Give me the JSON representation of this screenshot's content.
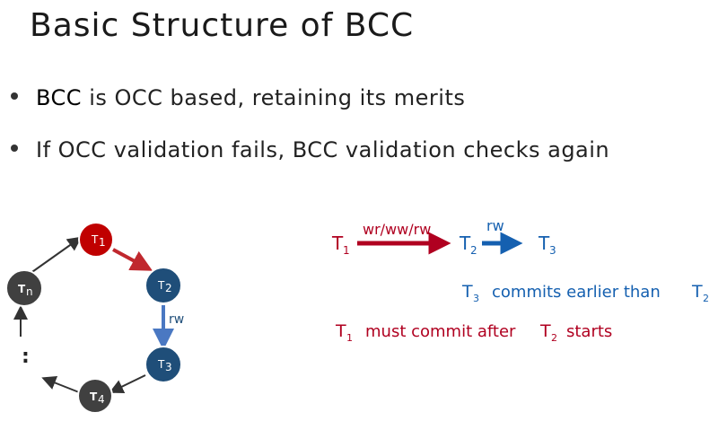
{
  "title": "Basic Structure of BCC",
  "bullets": [
    {
      "lead": "BCC",
      "rest": " is OCC based, retaining its merits"
    },
    {
      "lead": "",
      "rest": "If OCC validation fails, BCC validation checks again"
    }
  ],
  "cycle": {
    "nodes": [
      {
        "base": "T",
        "sub": "1",
        "color": "#c00000"
      },
      {
        "base": "T",
        "sub": "2",
        "color": "#1f4e79"
      },
      {
        "base": "T",
        "sub": "3",
        "color": "#1f4e79"
      },
      {
        "base": "T",
        "sub": "4",
        "color": "#404040"
      },
      {
        "base": "T",
        "sub": "n",
        "color": "#404040"
      }
    ],
    "edge_label_rw": "rw",
    "ellipsis": ":"
  },
  "chain": {
    "t1": {
      "base": "T",
      "sub": "1"
    },
    "t2": {
      "base": "T",
      "sub": "2"
    },
    "t3": {
      "base": "T",
      "sub": "3"
    },
    "label_wr": "wr/ww/rw",
    "label_rw": "rw"
  },
  "notes": {
    "blue_pre": "commits earlier than",
    "red_pre": "must commit after",
    "red_post": "starts"
  },
  "colors": {
    "red": "#b00020",
    "blue": "#1560b0",
    "dark_node": "#404040"
  }
}
